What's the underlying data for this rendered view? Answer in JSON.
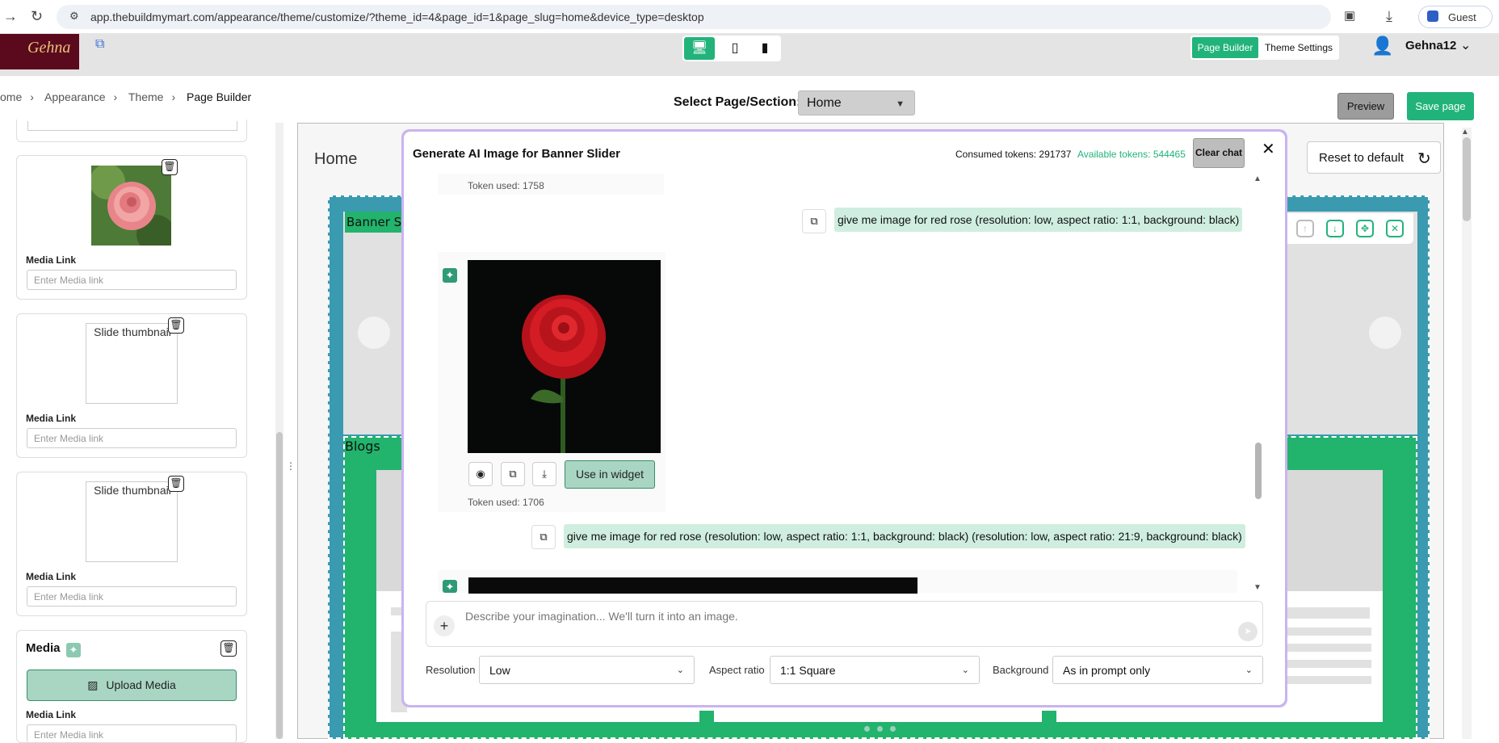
{
  "browser": {
    "url": "app.thebuildmymart.com/appearance/theme/customize/?theme_id=4&page_id=1&page_slug=home&device_type=desktop",
    "profile": "Guest"
  },
  "header": {
    "logo_text": "Gehna",
    "page_builder": "Page Builder",
    "theme_settings": "Theme Settings",
    "user": "Gehna12"
  },
  "breadcrumb": [
    "ome",
    "Appearance",
    "Theme",
    "Page Builder"
  ],
  "toolbar": {
    "select_label": "Select Page/Section:",
    "select_value": "Home",
    "preview": "Preview",
    "save": "Save page"
  },
  "left_panel": {
    "slides": [
      {
        "thumb_alt": "",
        "media_label": "Media Link",
        "media_placeholder": "Enter Media link"
      },
      {
        "thumb_alt": "Slide thumbnail",
        "media_label": "Media Link",
        "media_placeholder": "Enter Media link"
      },
      {
        "thumb_alt": "Slide thumbnail",
        "media_label": "Media Link",
        "media_placeholder": "Enter Media link"
      }
    ],
    "media_title": "Media",
    "upload_label": "Upload Media",
    "media_link_label": "Media Link",
    "media_link_placeholder": "Enter Media link"
  },
  "canvas": {
    "page_title": "Home",
    "reset_label": "Reset to default",
    "banner_label": "Banner S",
    "blogs_label": "Blogs"
  },
  "modal": {
    "title": "Generate AI Image for Banner Slider",
    "consumed": "Consumed tokens: 291737",
    "available": "Available tokens: 544465",
    "clear_chat": "Clear chat",
    "token_used_1": "Token used: 1758",
    "prompt_1": "give me image for red rose (resolution: low, aspect ratio: 1:1, background: black)",
    "use_in_widget": "Use in widget",
    "token_used_2": "Token used: 1706",
    "prompt_2": "give me image for red rose (resolution: low, aspect ratio: 1:1, background: black) (resolution: low, aspect ratio: 21:9, background: black)",
    "input_placeholder": "Describe your imagination... We'll turn it into an image.",
    "resolution_label": "Resolution",
    "resolution_value": "Low",
    "aspect_label": "Aspect ratio",
    "aspect_value": "1:1 Square",
    "background_label": "Background",
    "background_value": "As in prompt only"
  },
  "colors": {
    "accent": "#21b37a",
    "modal_border": "#c9b4f0"
  }
}
